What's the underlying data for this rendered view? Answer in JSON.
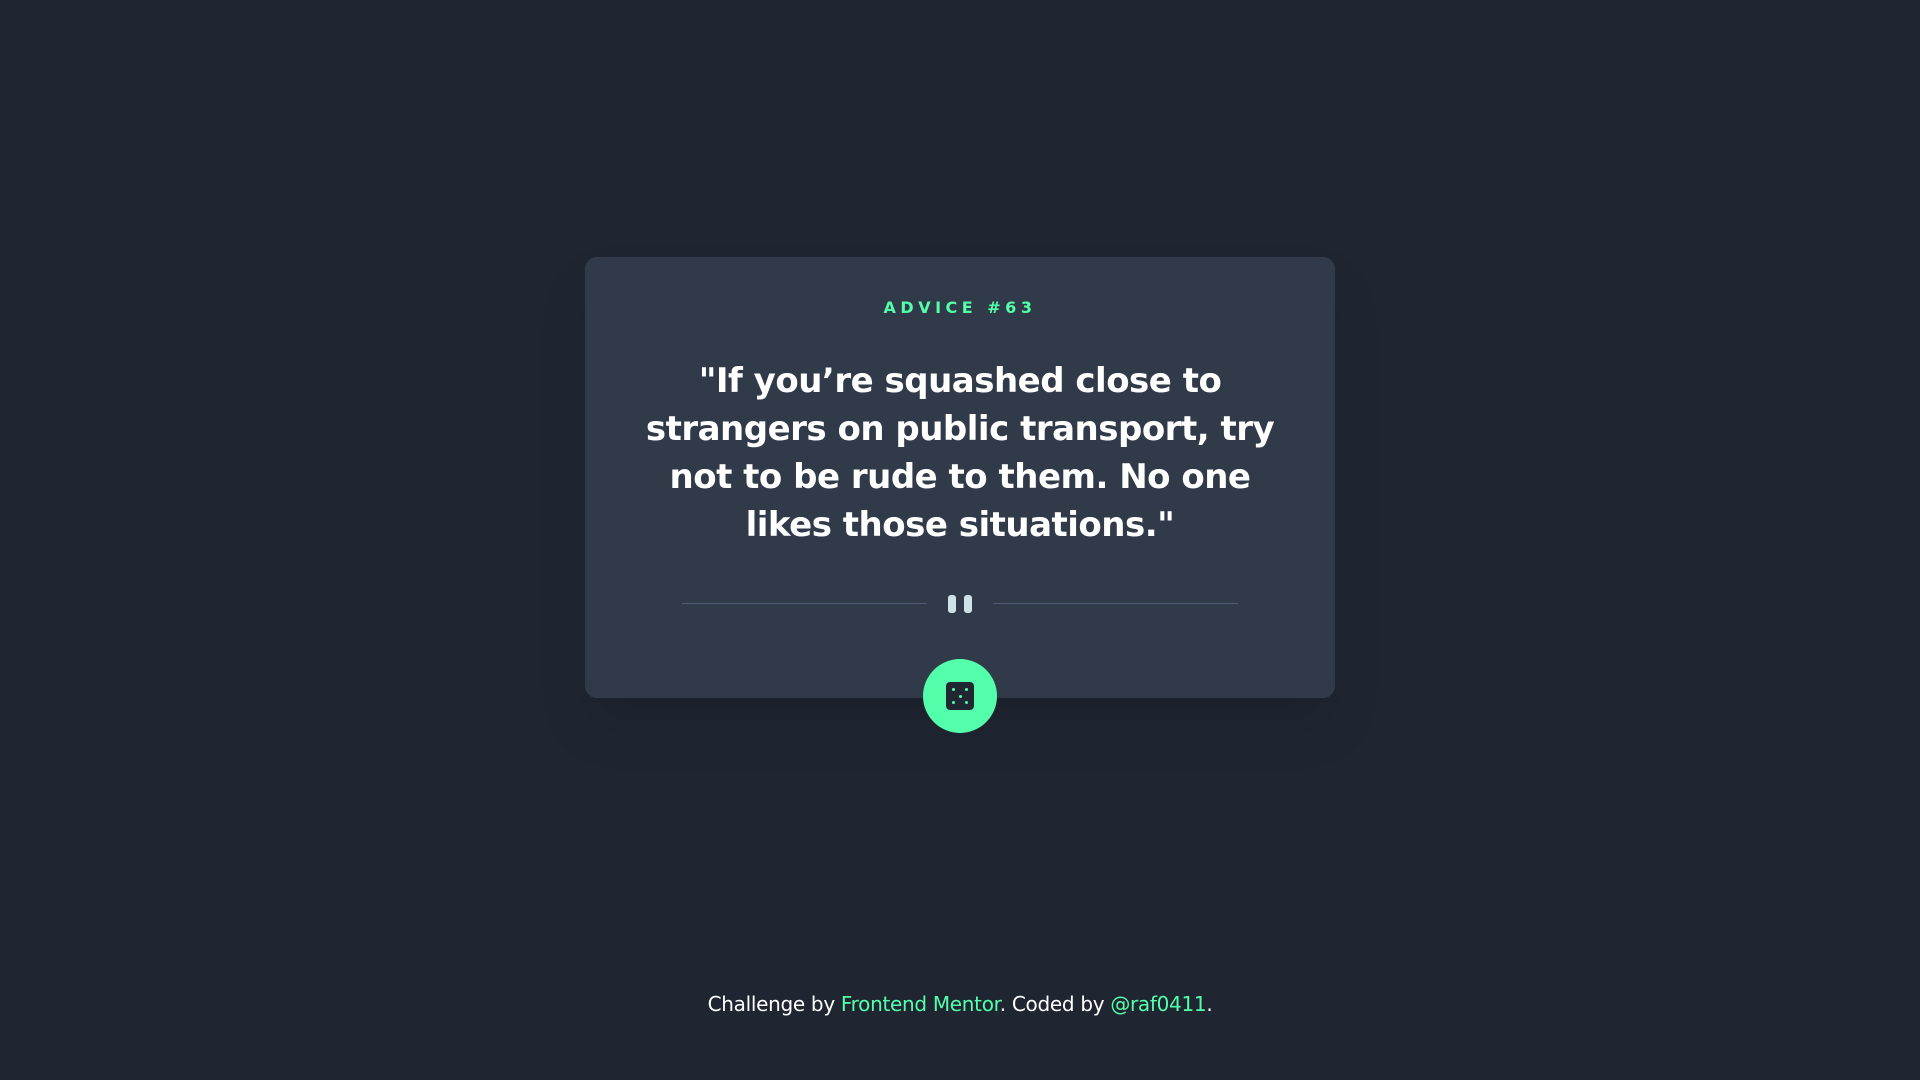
{
  "colors": {
    "background": "#1f2632",
    "card": "#313a48",
    "accent": "#53ffaa",
    "text": "#ffffff",
    "divider": "#4f5d74",
    "pause_icon": "#cee3e9"
  },
  "advice": {
    "id_label": "ADVICE #63",
    "quote": "\"If you’re squashed close to strangers on public transport, try not to be rude to them. No one likes those situations.\""
  },
  "divider": {
    "icon": "pause-icon"
  },
  "button": {
    "icon": "dice-icon"
  },
  "footer": {
    "prefix": "Challenge by ",
    "link1": "Frontend Mentor",
    "middle": ". Coded by ",
    "link2": "@raf0411",
    "suffix": "."
  }
}
